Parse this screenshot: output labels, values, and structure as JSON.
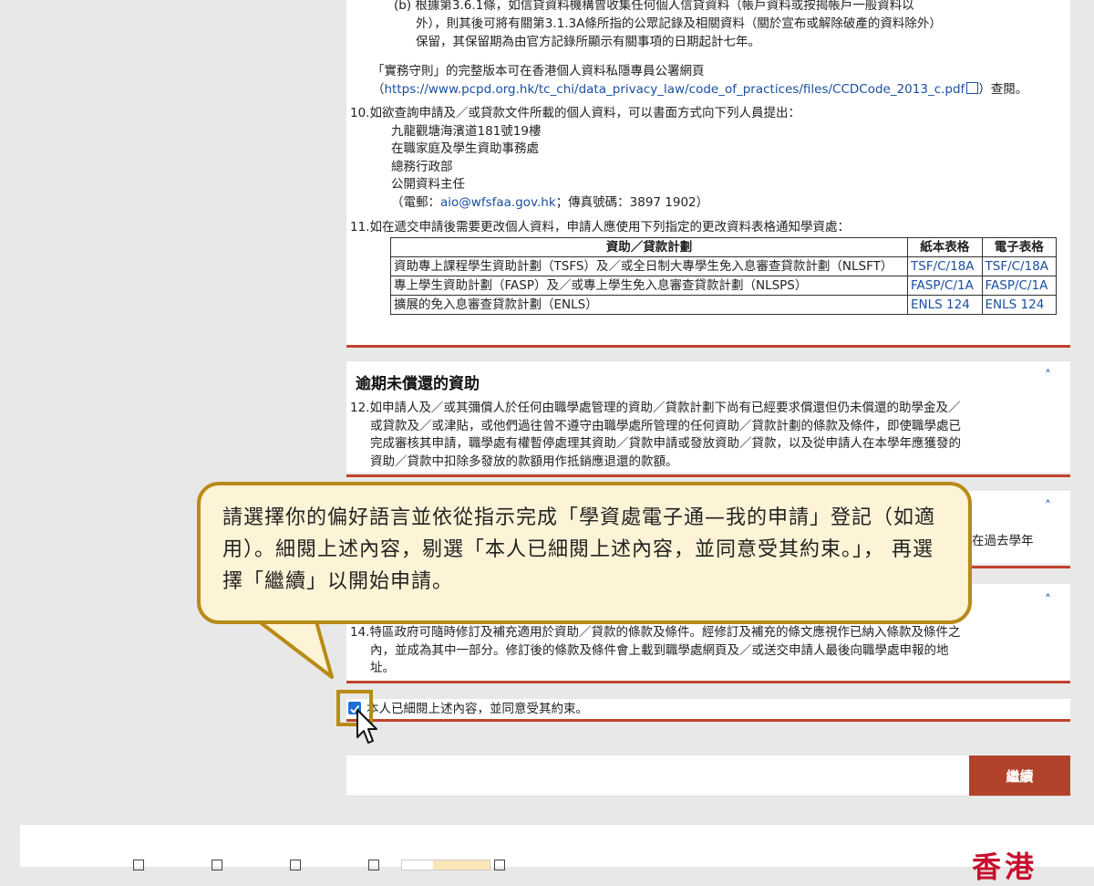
{
  "clause9b": {
    "line1": "(b) 根據第3.6.1條，如信貸資料機構曾收集任何個人信貸資料（帳戶資料或按揭帳戶一般資料以",
    "line2": "外），則其後可將有關第3.1.3A條所指的公眾記錄及相關資料（關於宣布或解除破產的資料除外）",
    "line3": "保留，其保留期為由官方記錄所顯示有關事項的日期起計七年。"
  },
  "code": {
    "line1": "「實務守則」的完整版本可在香港個人資料私隱專員公署網頁",
    "open": "（",
    "url": "https://www.pcpd.org.hk/tc_chi/data_privacy_law/code_of_practices/files/CCDCode_2013_c.pdf",
    "close": "）查閱。"
  },
  "item10": {
    "text": "10.如欲查詢申請及／或貸款文件所載的個人資料，可以書面方式向下列人員提出：",
    "address": "九龍觀塘海濱道181號19樓",
    "office": "在職家庭及學生資助事務處",
    "division": "總務行政部",
    "officer": "公開資料主任",
    "contact_pre": "（電郵：",
    "email": "aio@wfsfaa.gov.hk",
    "contact_post": "；傳真號碼：3897 1902）"
  },
  "item11": {
    "text": "11.如在遞交申請後需要更改個人資料，申請人應使用下列指定的更改資料表格通知學資處：",
    "headers": [
      "資助／貸款計劃",
      "紙本表格",
      "電子表格"
    ],
    "rows": [
      {
        "scheme": "資助專上課程學生資助計劃（TSFS）及／或全日制大專學生免入息審查貸款計劃（NLSFT）",
        "paper": "TSF/C/18A",
        "e": "TSF/C/18A"
      },
      {
        "scheme": "專上學生資助計劃（FASP）及／或專上學生免入息審查貸款計劃（NLSPS）",
        "paper": "FASP/C/1A",
        "e": "FASP/C/1A"
      },
      {
        "scheme": "擴展的免入息審查貸款計劃（ENLS）",
        "paper": "ENLS 124",
        "e": "ENLS 124"
      }
    ]
  },
  "overdue": {
    "title": "逾期未償還的資助",
    "l1": "12.如申請人及／或其彌償人於任何由職學處管理的資助／貸款計劃下尚有已經要求償還但仍未償還的助學金及／",
    "l2": "或貸款及／或津貼，或他們過往曾不遵守由職學處所管理的任何資助／貸款計劃的條款及條件，即使職學處已",
    "l3": "完成審核其申請，職學處有權暫停處理其資助／貸款申請或發放資助／貸款，以及從申請人在本學年應獲發的",
    "l4": "資助／貸款中扣除多發放的款額用作抵銷應退還的款額。"
  },
  "section13": {
    "partial": "在過去學年"
  },
  "item14": {
    "l1": "14.特區政府可隨時修訂及補充適用於資助／貸款的條款及條件。經修訂及補充的條文應視作已納入條款及條件之",
    "l2": "內，並成為其中一部分。修訂後的條款及條件會上載到職學處網頁及／或送交申請人最後向職學處申報的地",
    "l3": "址。"
  },
  "callout": {
    "text": "請選擇你的偏好語言並依從指示完成「學資處電子通—我的申請」登記（如適用）。細閱上述內容，剔選「本人已細閱上述內容，並同意受其約束。」， 再選擇「繼續」以開始申請。"
  },
  "agreement": {
    "label": "本人已細閱上述內容，並同意受其約束。",
    "checked": true
  },
  "continue_label": "繼續",
  "footer": {
    "logo_text": "香港"
  },
  "colors": {
    "accent": "#c1432c",
    "button": "#b2422b",
    "callout_border": "#b88b17",
    "callout_bg": "#fdf3d6",
    "link": "#1a4fa0"
  }
}
